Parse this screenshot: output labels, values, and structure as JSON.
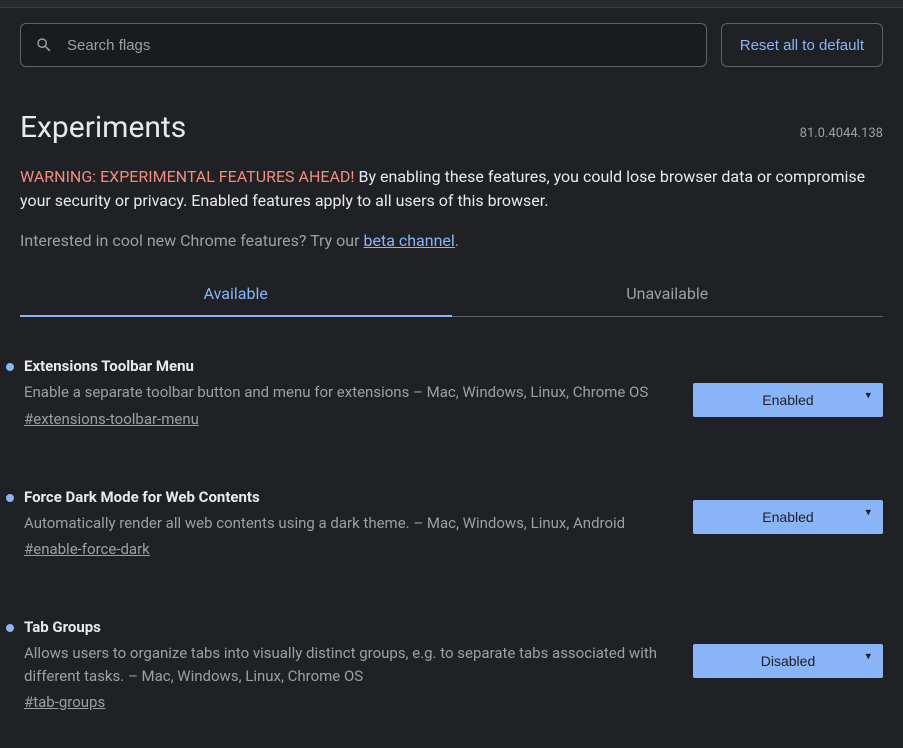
{
  "search": {
    "placeholder": "Search flags"
  },
  "resetButton": "Reset all to default",
  "pageTitle": "Experiments",
  "version": "81.0.4044.138",
  "warning": {
    "prefix": "WARNING: EXPERIMENTAL FEATURES AHEAD!",
    "body": " By enabling these features, you could lose browser data or compromise your security or privacy. Enabled features apply to all users of this browser."
  },
  "interest": {
    "text": "Interested in cool new Chrome features? Try our ",
    "linkText": "beta channel",
    "suffix": "."
  },
  "tabs": {
    "available": "Available",
    "unavailable": "Unavailable"
  },
  "flags": [
    {
      "title": "Extensions Toolbar Menu",
      "desc": "Enable a separate toolbar button and menu for extensions – Mac, Windows, Linux, Chrome OS",
      "anchor": "#extensions-toolbar-menu",
      "value": "Enabled"
    },
    {
      "title": "Force Dark Mode for Web Contents",
      "desc": "Automatically render all web contents using a dark theme. – Mac, Windows, Linux, Android",
      "anchor": "#enable-force-dark",
      "value": "Enabled"
    },
    {
      "title": "Tab Groups",
      "desc": "Allows users to organize tabs into visually distinct groups, e.g. to separate tabs associated with different tasks. – Mac, Windows, Linux, Chrome OS",
      "anchor": "#tab-groups",
      "value": "Disabled"
    }
  ]
}
